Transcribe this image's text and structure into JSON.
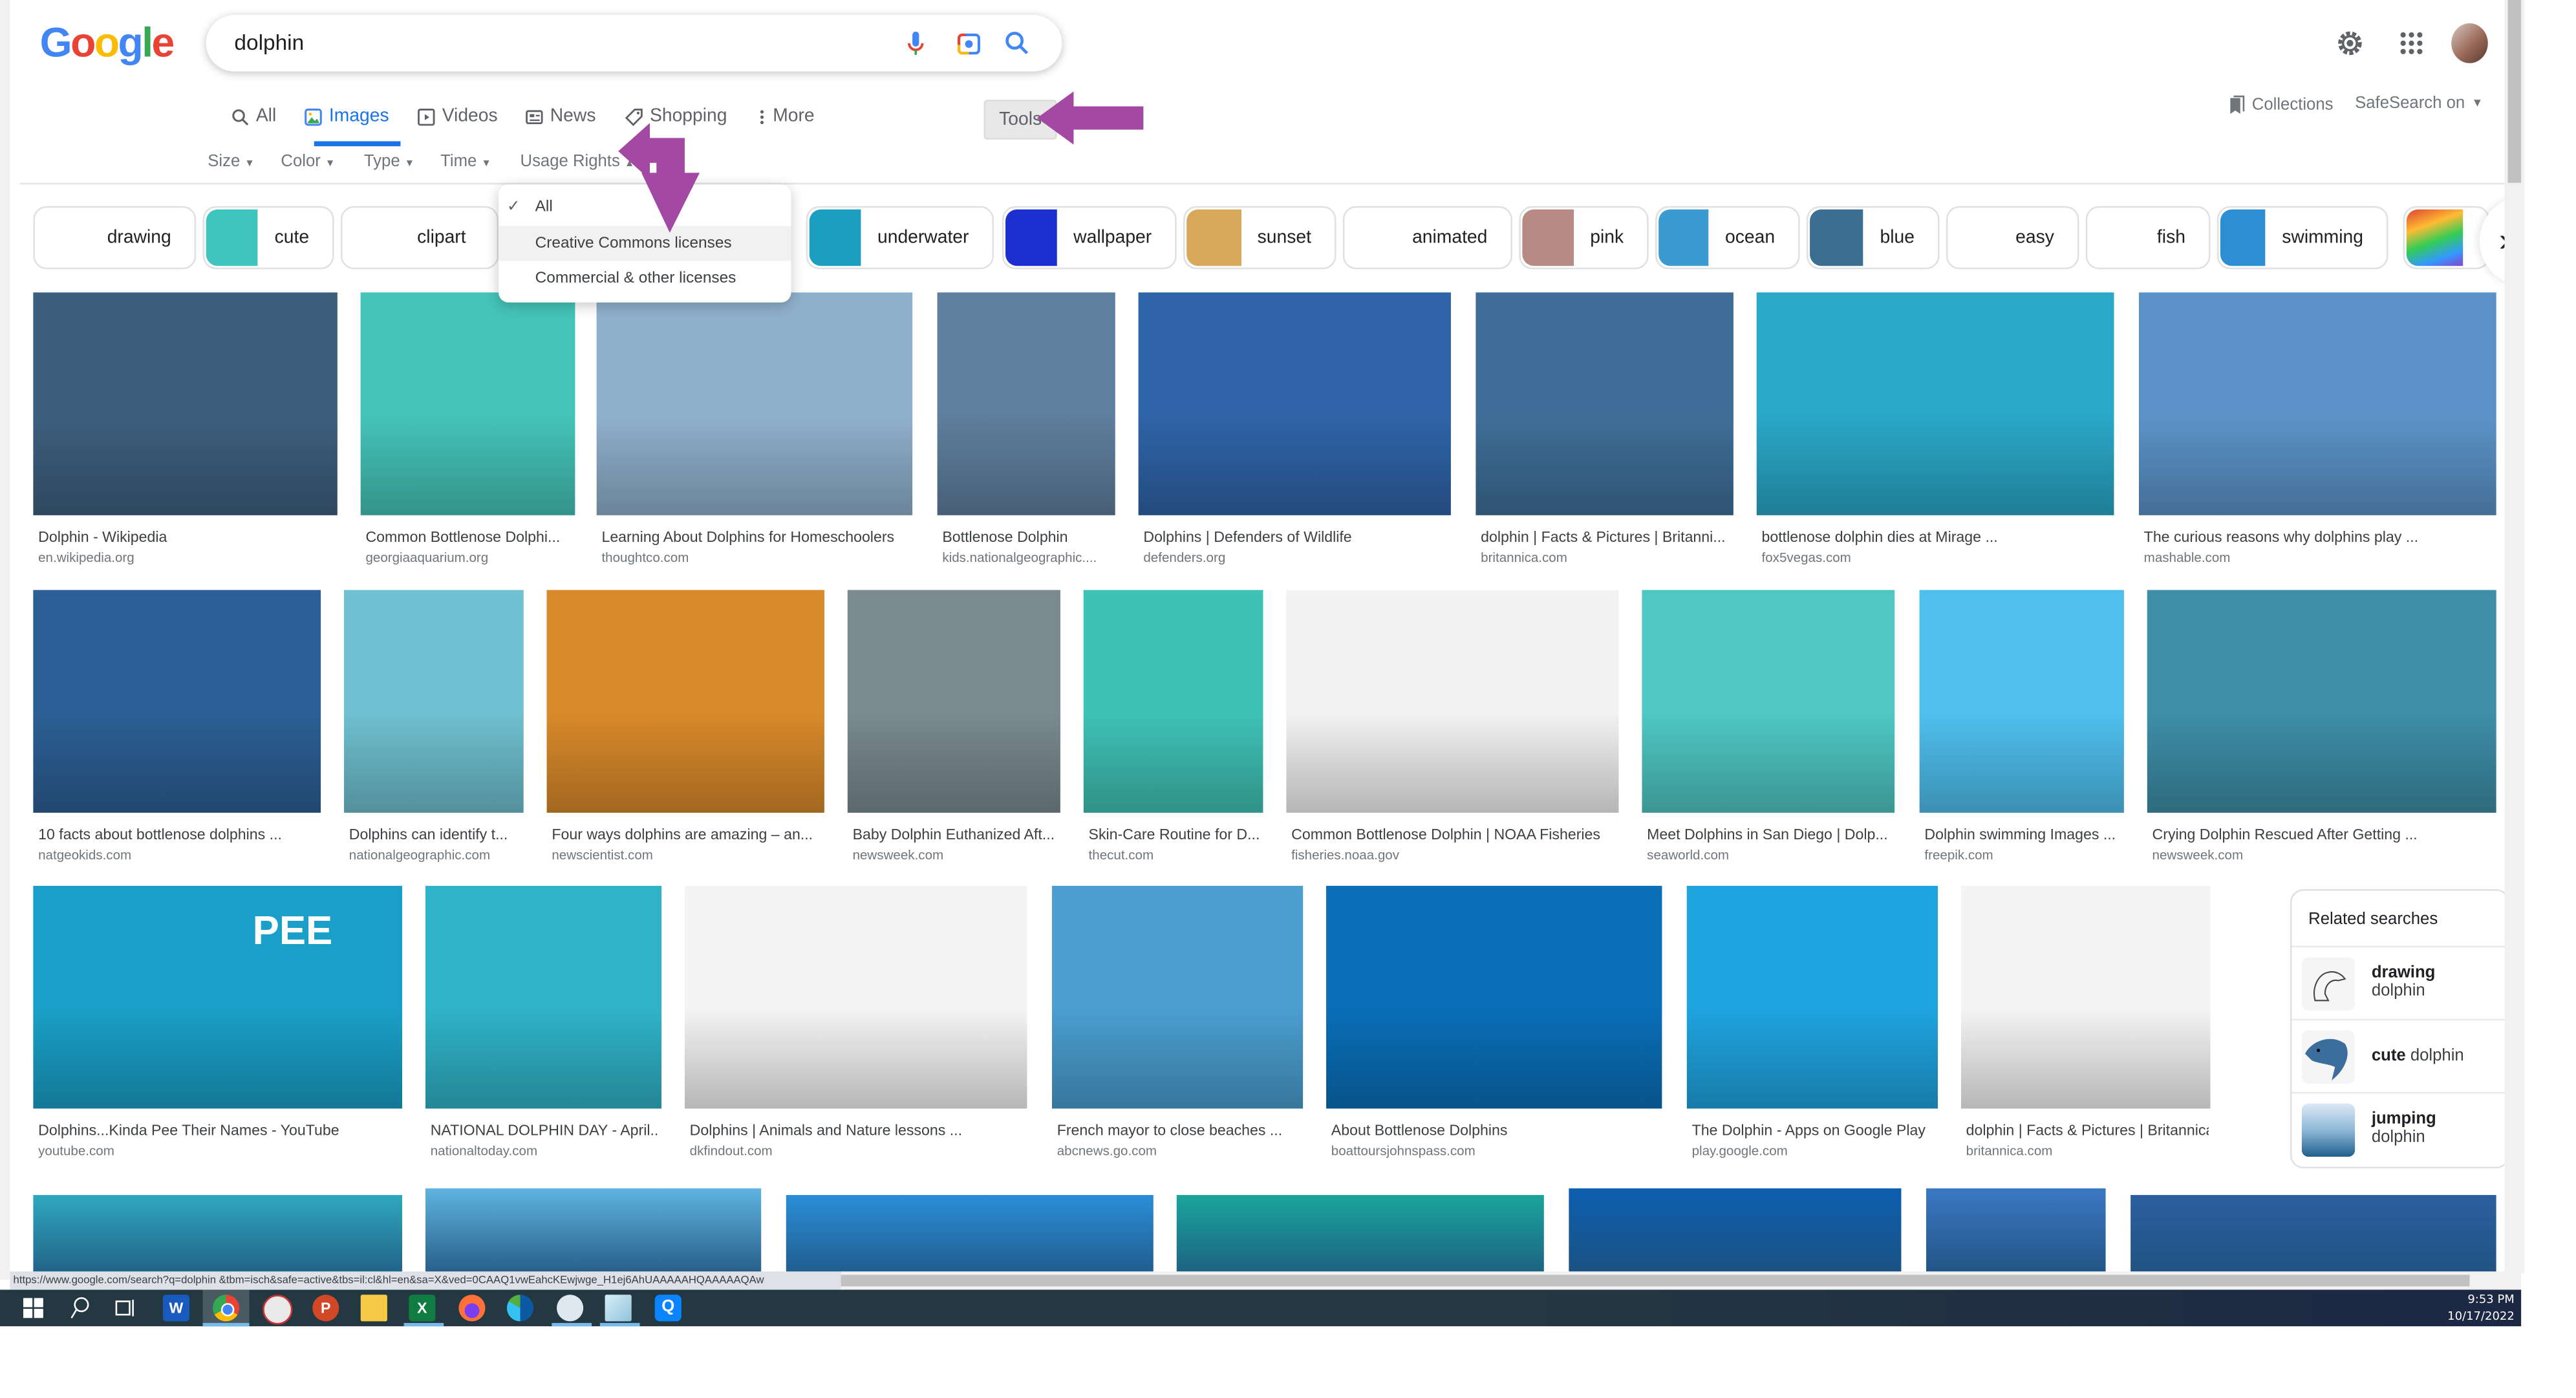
{
  "header": {
    "logo_letters": [
      {
        "char": "G",
        "color": "#4285F4"
      },
      {
        "char": "o",
        "color": "#EA4335"
      },
      {
        "char": "o",
        "color": "#FBBC05"
      },
      {
        "char": "g",
        "color": "#4285F4"
      },
      {
        "char": "l",
        "color": "#34A853"
      },
      {
        "char": "e",
        "color": "#EA4335"
      }
    ],
    "search_value": "dolphin",
    "search_icons": [
      "microphone-icon",
      "camera-lens-icon",
      "search-icon"
    ],
    "right_icons": [
      "gear-icon",
      "apps-grid-icon",
      "avatar"
    ]
  },
  "nav": {
    "tabs": [
      {
        "label": "All",
        "icon": "search-icon",
        "active": false
      },
      {
        "label": "Images",
        "icon": "image-icon",
        "active": true
      },
      {
        "label": "Videos",
        "icon": "video-icon",
        "active": false
      },
      {
        "label": "News",
        "icon": "news-icon",
        "active": false
      },
      {
        "label": "Shopping",
        "icon": "tag-icon",
        "active": false
      },
      {
        "label": "More",
        "icon": "more-vert-icon",
        "active": false
      }
    ],
    "tools_label": "Tools",
    "collections_label": "Collections",
    "safesearch_label": "SafeSearch on"
  },
  "filters": {
    "items": [
      "Size",
      "Color",
      "Type",
      "Time",
      "Usage Rights"
    ],
    "open": "Usage Rights"
  },
  "usage_rights_menu": {
    "items": [
      {
        "label": "All",
        "checked": true
      },
      {
        "label": "Creative Commons licenses",
        "highlighted": true
      },
      {
        "label": "Commercial & other licenses"
      }
    ]
  },
  "chips": [
    {
      "label": "drawing",
      "thumb": "#ffffff"
    },
    {
      "label": "cute",
      "thumb": "#3fc5c0"
    },
    {
      "label": "clipart",
      "thumb": "#ffffff"
    },
    {
      "label": "underwater",
      "thumb": "#1a9fc0"
    },
    {
      "label": "wallpaper",
      "thumb": "#1d2fd0"
    },
    {
      "label": "sunset",
      "thumb": "#d8a95a"
    },
    {
      "label": "animated",
      "thumb": "#ffffff"
    },
    {
      "label": "pink",
      "thumb": "#b88a84"
    },
    {
      "label": "ocean",
      "thumb": "#3b9ad0"
    },
    {
      "label": "blue",
      "thumb": "#3c6e92"
    },
    {
      "label": "easy",
      "thumb": "#ffffff"
    },
    {
      "label": "fish",
      "thumb": "#ffffff"
    },
    {
      "label": "swimming",
      "thumb": "#2c8fd4"
    }
  ],
  "results": [
    {
      "title": "Dolphin - Wikipedia",
      "source": "en.wikipedia.org",
      "color": "#3d5f7e"
    },
    {
      "title": "Common Bottlenose Dolphi...",
      "source": "georgiaaquarium.org",
      "color": "#45c4b9"
    },
    {
      "title": "Learning About Dolphins for Homeschoolers",
      "source": "thoughtco.com",
      "color": "#8fb0cc"
    },
    {
      "title": "Bottlenose Dolphin",
      "source": "kids.nationalgeographic....",
      "color": "#5f7f9e"
    },
    {
      "title": "Dolphins | Defenders of Wildlife",
      "source": "defenders.org",
      "color": "#2f64a8"
    },
    {
      "title": "dolphin | Facts & Pictures | Britanni...",
      "source": "britannica.com",
      "color": "#3f6f98"
    },
    {
      "title": "bottlenose dolphin dies at Mirage ...",
      "source": "fox5vegas.com",
      "color": "#2aa8c8"
    },
    {
      "title": "The curious reasons why dolphins play ...",
      "source": "mashable.com",
      "color": "#5b93c8"
    },
    {
      "title": "10 facts about bottlenose dolphins ...",
      "source": "natgeokids.com",
      "color": "#2c5f95"
    },
    {
      "title": "Dolphins can identify t...",
      "source": "nationalgeographic.com",
      "color": "#6fc0d0"
    },
    {
      "title": "Four ways dolphins are amazing – an...",
      "source": "newscientist.com",
      "color": "#d98a2a"
    },
    {
      "title": "Baby Dolphin Euthanized Aft...",
      "source": "newsweek.com",
      "color": "#7a8a90"
    },
    {
      "title": "Skin-Care Routine for D...",
      "source": "thecut.com",
      "color": "#3fc2b6"
    },
    {
      "title": "Common Bottlenose Dolphin | NOAA Fisheries",
      "source": "fisheries.noaa.gov",
      "color": "#f2f2f2"
    },
    {
      "title": "Meet Dolphins in San Diego | Dolp...",
      "source": "seaworld.com",
      "color": "#4fc8c4"
    },
    {
      "title": "Dolphin swimming Images ...",
      "source": "freepik.com",
      "color": "#4fc0ee"
    },
    {
      "title": "Crying Dolphin Rescued After Getting ...",
      "source": "newsweek.com",
      "color": "#3e8ea8"
    },
    {
      "title": "Dolphins...Kinda Pee Their Names - YouTube",
      "source": "youtube.com",
      "color": "#1aa0c8"
    },
    {
      "title": "NATIONAL DOLPHIN DAY - April...",
      "source": "nationaltoday.com",
      "color": "#2fb3c8"
    },
    {
      "title": "Dolphins | Animals and Nature lessons ...",
      "source": "dkfindout.com",
      "color": "#f4f4f4"
    },
    {
      "title": "French mayor to close beaches ...",
      "source": "abcnews.go.com",
      "color": "#4a9ed0"
    },
    {
      "title": "About Bottlenose Dolphins",
      "source": "boattoursjohnspass.com",
      "color": "#0a6fb8"
    },
    {
      "title": "The Dolphin - Apps on Google Play",
      "source": "play.google.com",
      "color": "#1fa4e0"
    },
    {
      "title": "dolphin | Facts & Pictures | Britannica",
      "source": "britannica.com",
      "color": "#f4f4f4"
    }
  ],
  "partial_row_colors": [
    "#2fa8bd",
    "#5fb4e0",
    "#2b8ed8",
    "#1aa59c",
    "#0d5fb0",
    "#3b78c4",
    "#2c5fa0"
  ],
  "thumb_overlay": {
    "text": "PEE"
  },
  "related": {
    "title": "Related searches",
    "items": [
      {
        "bold": "drawing",
        "rest": "dolphin"
      },
      {
        "bold": "cute",
        "rest": "dolphin"
      },
      {
        "bold": "jumping",
        "rest": "dolphin"
      }
    ]
  },
  "status_url": "https://www.google.com/search?q=dolphin &tbm=isch&safe=active&tbs=il:cl&hl=en&sa=X&ved=0CAAQ1vwEahcKEwjwge_H1ej6AhUAAAAAHQAAAAAQAw",
  "taskbar": {
    "apps": [
      "windows-start-icon",
      "search-icon",
      "task-view-icon",
      "word-icon",
      "chrome-icon",
      "snipping-tool-icon",
      "powerpoint-icon",
      "file-explorer-icon",
      "excel-icon",
      "firefox-icon",
      "edge-icon",
      "paint-icon",
      "notepad-icon",
      "app-icon"
    ],
    "time": "9:53 PM",
    "date": "10/17/2022"
  },
  "annotation_color": "#A349A4"
}
